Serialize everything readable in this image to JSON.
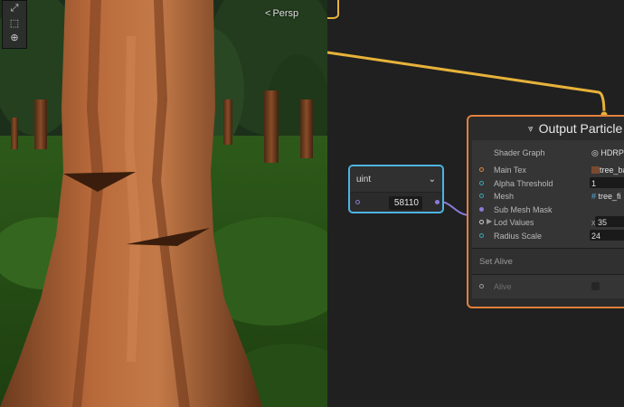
{
  "scene": {
    "view_label": "Persp",
    "tools": [
      "move-tool-icon",
      "rect-tool-icon",
      "transform-tool-icon"
    ]
  },
  "uint_node": {
    "title": "uint",
    "value": "58110"
  },
  "output_node": {
    "title": "Output Particle",
    "properties": [
      {
        "label": "Shader Graph",
        "value": "HDRPV"
      },
      {
        "label": "Main Tex",
        "value": "tree_ba"
      },
      {
        "label": "Alpha Threshold",
        "value": "1"
      },
      {
        "label": "Mesh",
        "value": "tree_fi"
      },
      {
        "label": "Sub Mesh Mask",
        "value": ""
      },
      {
        "label": "Lod Values",
        "value": "35",
        "prefix": "x"
      },
      {
        "label": "Radius Scale",
        "value": "24"
      }
    ],
    "section_label": "Set Alive",
    "alive_label": "Alive"
  },
  "colors": {
    "uint_border": "#4fb3e3",
    "output_border": "#e3813c",
    "edge": "#e6b23a",
    "link": "#8a7bd8"
  }
}
